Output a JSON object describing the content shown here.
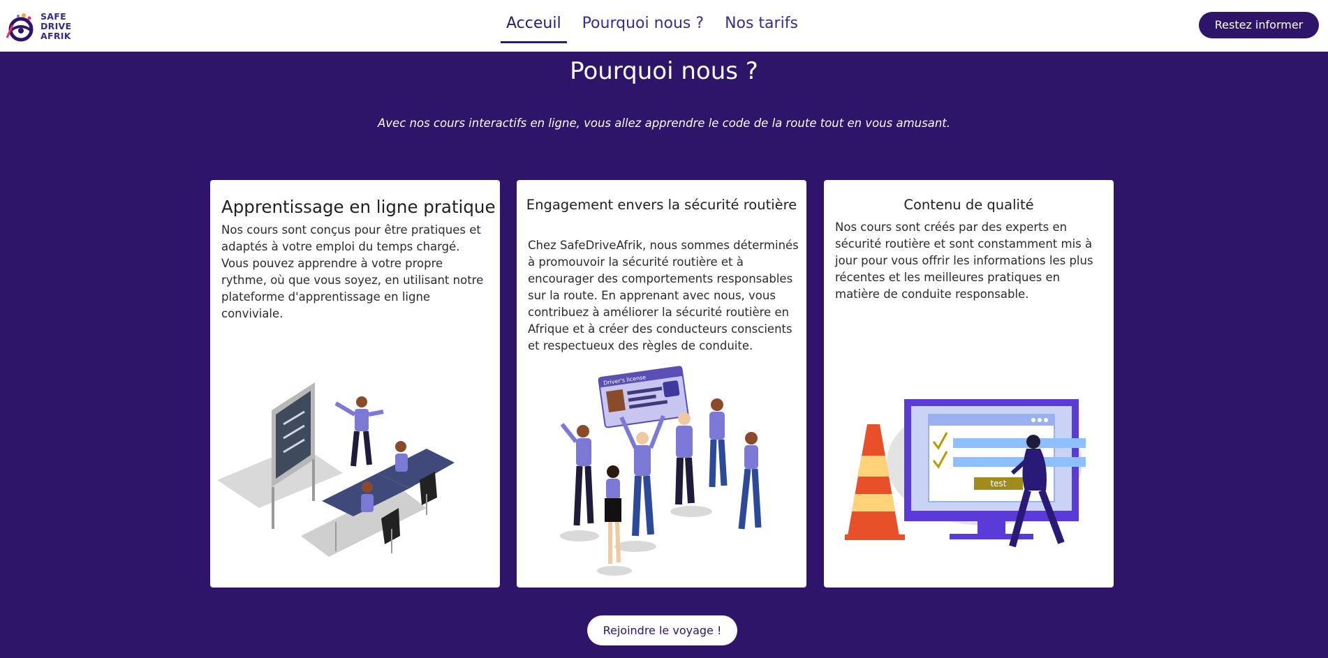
{
  "brand": {
    "logo_lines": [
      "SAFE",
      "DRIVE",
      "AFRIK"
    ]
  },
  "nav": {
    "items": [
      {
        "label": "Acceuil",
        "active": true
      },
      {
        "label": "Pourquoi nous ?",
        "active": false
      },
      {
        "label": "Nos tarifs",
        "active": false
      }
    ],
    "cta_label": "Restez informer"
  },
  "main": {
    "title": "Pourquoi nous ?",
    "subtitle": "Avec nos cours interactifs en ligne, vous allez apprendre le code de la route tout en vous amusant.",
    "cards": [
      {
        "title": "Apprentissage en ligne pratique",
        "text": "Nos cours sont conçus pour être pratiques et adaptés à votre emploi du temps chargé. Vous pouvez apprendre à votre propre rythme, où que vous soyez, en utilisant notre plateforme d'apprentissage en ligne conviviale."
      },
      {
        "title": "Engagement envers la sécurité routière",
        "text": "Chez SafeDriveAfrik, nous sommes déterminés à promouvoir la sécurité routière et à encourager des comportements responsables sur la route. En apprenant avec nous, vous contribuez à améliorer la sécurité routière en Afrique et à créer des conducteurs conscients et respectueux des règles de conduite."
      },
      {
        "title": "Contenu de qualité",
        "text": "Nos cours sont créés par des experts en sécurité routière et sont constamment mis à jour pour vous offrir les informations les plus récentes et les meilleures pratiques en matière de conduite responsable."
      }
    ],
    "license_card_label": "Driver's license",
    "test_label": "test",
    "cta_label": "Rejoindre le voyage !"
  },
  "colors": {
    "primary": "#2f1569",
    "accent": "#7b78d6",
    "white": "#ffffff"
  }
}
